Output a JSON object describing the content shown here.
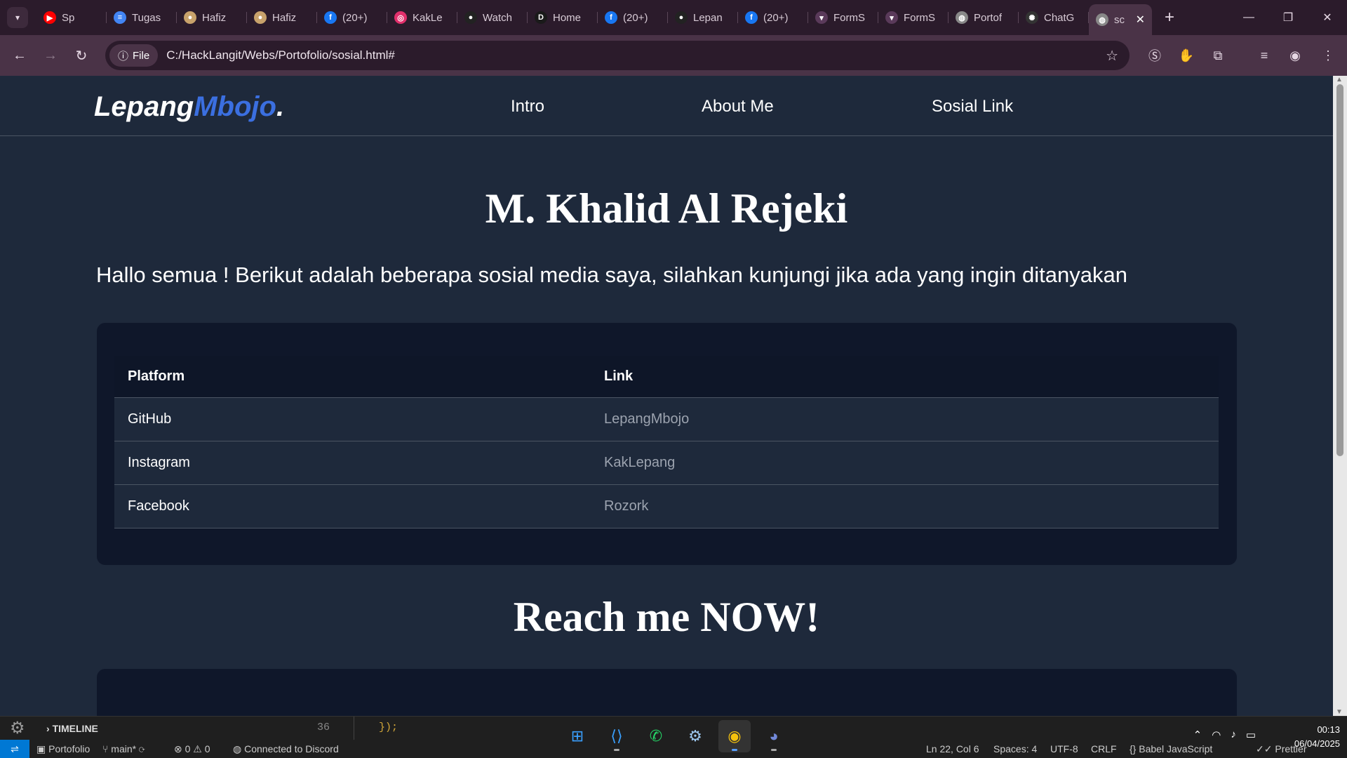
{
  "browser": {
    "tabs": [
      {
        "label": "Sp",
        "icon": "youtube-icon",
        "color": "#ff0000",
        "glyph": "▶"
      },
      {
        "label": "Tugas",
        "icon": "docs-icon",
        "color": "#4285f4",
        "glyph": "≡"
      },
      {
        "label": "Hafiz",
        "icon": "site-icon",
        "color": "#c8a26b",
        "glyph": "●"
      },
      {
        "label": "Hafiz",
        "icon": "site-icon",
        "color": "#c8a26b",
        "glyph": "●"
      },
      {
        "label": "(20+)",
        "icon": "facebook-icon",
        "color": "#1877f2",
        "glyph": "f"
      },
      {
        "label": "KakLe",
        "icon": "instagram-icon",
        "color": "#e1306c",
        "glyph": "◎"
      },
      {
        "label": "Watch",
        "icon": "github-icon",
        "color": "#222222",
        "glyph": "●"
      },
      {
        "label": "Home",
        "icon": "d-icon",
        "color": "#1a1a1a",
        "glyph": "D"
      },
      {
        "label": "(20+)",
        "icon": "facebook-icon",
        "color": "#1877f2",
        "glyph": "f"
      },
      {
        "label": "Lepan",
        "icon": "github-icon",
        "color": "#222222",
        "glyph": "●"
      },
      {
        "label": "(20+)",
        "icon": "facebook-icon",
        "color": "#1877f2",
        "glyph": "f"
      },
      {
        "label": "FormS",
        "icon": "forms-icon",
        "color": "#5a3a5a",
        "glyph": "▾"
      },
      {
        "label": "FormS",
        "icon": "forms-icon",
        "color": "#5a3a5a",
        "glyph": "▾"
      },
      {
        "label": "Portof",
        "icon": "globe-icon",
        "color": "#888888",
        "glyph": "◍"
      },
      {
        "label": "ChatG",
        "icon": "chatgpt-icon",
        "color": "#333333",
        "glyph": "✺"
      }
    ],
    "active_tab": {
      "label": "sc",
      "icon": "globe-icon"
    },
    "address_chip": "File",
    "url": "C:/HackLangit/Webs/Portofolio/sosial.html#"
  },
  "site": {
    "logo_main": "Lepang",
    "logo_accent": "Mbojo",
    "logo_dot": ".",
    "accent_color": "#3b6fe0",
    "nav": [
      {
        "label": "Intro"
      },
      {
        "label": "About Me"
      },
      {
        "label": "Sosial Link"
      }
    ],
    "title": "M. Khalid Al Rejeki",
    "intro": "Hallo semua ! Berikut adalah beberapa sosial media saya, silahkan kunjungi jika ada yang ingin ditanyakan",
    "table": {
      "headers": [
        "Platform",
        "Link"
      ],
      "rows": [
        {
          "platform": "GitHub",
          "link": "LepangMbojo"
        },
        {
          "platform": "Instagram",
          "link": "KakLepang"
        },
        {
          "platform": "Facebook",
          "link": "Rozork"
        }
      ]
    },
    "reach_title": "Reach me NOW!"
  },
  "editor": {
    "timeline": "TIMELINE",
    "line_number": "36",
    "code": "});"
  },
  "statusbar": {
    "folder": "Portofolio",
    "branch": "main*",
    "problems": "⊗ 0 ⚠ 0",
    "discord": "Connected to Discord",
    "position": "Ln 22, Col 6",
    "spaces": "Spaces: 4",
    "encoding": "UTF-8",
    "eol": "CRLF",
    "language": "Babel JavaScript",
    "formatter": "Prettier"
  },
  "taskbar": {
    "time": "00:13",
    "date": "06/04/2025"
  }
}
